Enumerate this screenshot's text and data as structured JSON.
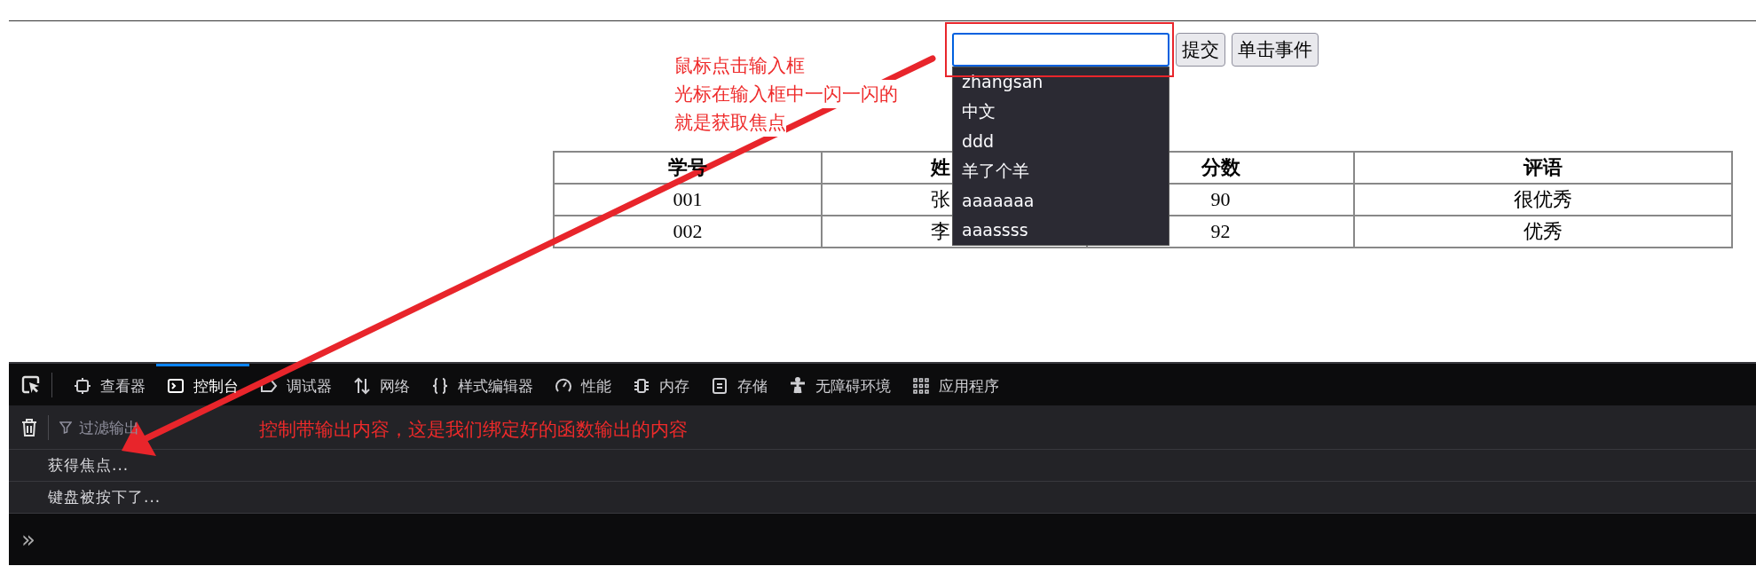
{
  "focus_note": {
    "lines": [
      "鼠标点击输入框",
      "光标在输入框中一闪一闪的",
      "就是获取焦点"
    ]
  },
  "search_input": {
    "focused": true
  },
  "buttons": [
    "提交",
    "单击事件"
  ],
  "autocomplete": [
    "zhangsan",
    "中文",
    "ddd",
    "羊了个羊",
    "aaaaaaa",
    "aaassss"
  ],
  "table": {
    "columns": [
      "学号",
      "姓",
      "分数",
      "评语"
    ],
    "rows": [
      [
        "001",
        "张",
        "90",
        "很优秀"
      ],
      [
        "002",
        "李",
        "92",
        "优秀"
      ]
    ]
  },
  "devtools": {
    "tabs": [
      {
        "label": "查看器",
        "selected": false
      },
      {
        "label": "控制台",
        "selected": true
      },
      {
        "label": "调试器",
        "selected": false
      },
      {
        "label": "网络",
        "selected": false
      },
      {
        "label": "样式编辑器",
        "selected": false
      },
      {
        "label": "性能",
        "selected": false
      },
      {
        "label": "内存",
        "selected": false
      },
      {
        "label": "存储",
        "selected": false
      },
      {
        "label": "无障碍环境",
        "selected": false
      },
      {
        "label": "应用程序",
        "selected": false
      }
    ],
    "filter_placeholder": "过滤输出",
    "messages": [
      "获得焦点...",
      "键盘被按下了..."
    ],
    "prompt": "»"
  },
  "console_note": "控制带输出内容，这是我们绑定好的函数输出的内容"
}
